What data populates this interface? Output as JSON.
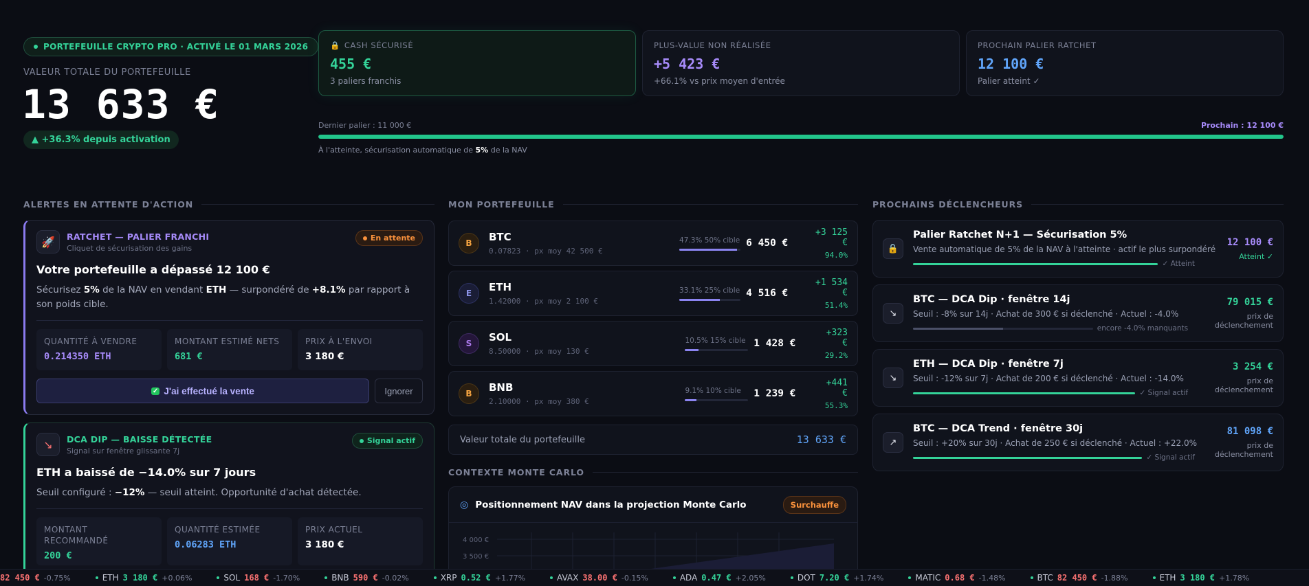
{
  "header": {
    "activation_badge": "PORTEFEUILLE CRYPTO PRO · ACTIVÉ LE 01 MARS 2026",
    "total_label": "VALEUR TOTALE DU PORTEFEUILLE",
    "total_value": "13 633  €",
    "change": "▲ +36.3% depuis activation"
  },
  "kpis": [
    {
      "label": "CASH SÉCURISÉ",
      "value": "455  €",
      "sub": "3 paliers franchis",
      "icon": "lock-icon"
    },
    {
      "label": "PLUS-VALUE NON RÉALISÉE",
      "value": "+5 423  €",
      "sub": "+66.1% vs prix moyen d'entrée"
    },
    {
      "label": "PROCHAIN PALIER RATCHET",
      "value": "12 100  €",
      "sub": "Palier atteint ✓"
    }
  ],
  "progress": {
    "left_label": "Dernier palier : 11 000 €",
    "right_label": "Prochain : 12 100 €",
    "fill": 1.0,
    "note_pre": "À l'atteinte, sécurisation automatique de ",
    "note_bold": "5%",
    "note_post": " de la NAV"
  },
  "columns": {
    "alerts": "ALERTES EN ATTENTE D'ACTION",
    "portfolio": "MON PORTEFEUILLE",
    "triggers": "PROCHAINS DÉCLENCHEURS",
    "monte_carlo": "CONTEXTE MONTE CARLO"
  },
  "alerts": {
    "ratchet": {
      "kind": "RATCHET — PALIER FRANCHI",
      "sub": "Cliquet de sécurisation des gains",
      "status": "En attente",
      "title": "Votre portefeuille a dépassé 12 100 €",
      "desc_1": "Sécurisez ",
      "desc_b1": "5%",
      "desc_2": " de la NAV en vendant ",
      "desc_b2": "ETH",
      "desc_3": " — surpondéré de ",
      "desc_b3": "+8.1%",
      "desc_4": " par rapport à son poids cible.",
      "stats": [
        {
          "label": "QUANTITÉ À VENDRE",
          "value": "0.214350 ETH"
        },
        {
          "label": "MONTANT ESTIMÉ NETS",
          "value": "681  €"
        },
        {
          "label": "PRIX À L'ENVOI",
          "value": "3 180 €"
        }
      ],
      "confirm": "J'ai effectué la vente",
      "ignore": "Ignorer"
    },
    "dca": {
      "kind": "DCA DIP — BAISSE DÉTECTÉE",
      "sub": "Signal sur fenêtre glissante 7j",
      "status": "Signal actif",
      "title": "ETH a baissé de −14.0% sur 7 jours",
      "desc_1": "Seuil configuré : ",
      "desc_b1": "−12%",
      "desc_2": " — seuil atteint. Opportunité d'achat détectée.",
      "stats": [
        {
          "label": "MONTANT RECOMMANDÉ",
          "value": "200  €"
        },
        {
          "label": "QUANTITÉ ESTIMÉE",
          "value": "0.06283 ETH"
        },
        {
          "label": "PRIX ACTUEL",
          "value": "3 180 €"
        }
      ]
    }
  },
  "assets": [
    {
      "coin": "B",
      "sym": "BTC",
      "qty": "0.07823 · px moy 42 500 €",
      "alloc": "47.3%  50% cible",
      "alloc_fill": 0.473,
      "value": "6 450  €",
      "pnl": "+3 125  €",
      "pct": "94.0%",
      "style": "coin-btc"
    },
    {
      "coin": "E",
      "sym": "ETH",
      "qty": "1.42000 · px moy 2 100 €",
      "alloc": "33.1%  25% cible",
      "alloc_fill": 0.331,
      "value": "4 516  €",
      "pnl": "+1 534  €",
      "pct": "51.4%",
      "style": "coin-eth"
    },
    {
      "coin": "S",
      "sym": "SOL",
      "qty": "8.50000 · px moy 130 €",
      "alloc": "10.5%  15% cible",
      "alloc_fill": 0.105,
      "value": "1 428  €",
      "pnl": "+323  €",
      "pct": "29.2%",
      "style": "coin-sol"
    },
    {
      "coin": "B",
      "sym": "BNB",
      "qty": "2.10000 · px moy 380 €",
      "alloc": "9.1%  10% cible",
      "alloc_fill": 0.091,
      "value": "1 239  €",
      "pnl": "+441  €",
      "pct": "55.3%",
      "style": "coin-btc"
    }
  ],
  "portfolio_total": {
    "label": "Valeur totale du portefeuille",
    "value": "13 633  €"
  },
  "monte_carlo": {
    "title": "Positionnement NAV dans la projection Monte Carlo",
    "status": "Surchauffe",
    "y_ticks": [
      "4 000 €",
      "3 500 €"
    ]
  },
  "triggers": [
    {
      "title": "Palier Ratchet N+1 — Sécurisation 5%",
      "desc": "Vente automatique de 5% de la NAV à l'atteinte · actif le plus surpondéré",
      "state": "✓ Atteint",
      "fill": 1.0,
      "price": "12 100  €",
      "note": "Atteint ✓",
      "icon": "lock-icon",
      "color": "#a78bfa"
    },
    {
      "title": "BTC — DCA Dip · fenêtre 14j",
      "desc": "Seuil : -8% sur 14j · Achat de 300 € si déclenché · Actuel : -4.0%",
      "state": "encore -4.0% manquants",
      "fill": 0.5,
      "price": "79 015  €",
      "note": "prix de déclenchement",
      "icon": "chart-down-icon",
      "color": "#34d399"
    },
    {
      "title": "ETH — DCA Dip · fenêtre 7j",
      "desc": "Seuil : -12% sur 7j · Achat de 200 € si déclenché · Actuel : -14.0%",
      "state": "✓ Signal actif",
      "fill": 1.0,
      "price": "3 254  €",
      "note": "prix de déclenchement",
      "icon": "chart-down-icon",
      "color": "#34d399"
    },
    {
      "title": "BTC — DCA Trend · fenêtre 30j",
      "desc": "Seuil : +20% sur 30j · Achat de 250 € si déclenché · Actuel : +22.0%",
      "state": "✓ Signal actif",
      "fill": 1.0,
      "price": "81 098  €",
      "note": "prix de déclenchement",
      "icon": "chart-up-icon",
      "color": "#60a5fa"
    }
  ],
  "ticker": [
    {
      "sym": "",
      "price": "82 450  €",
      "chg": "-0.75%",
      "color": "#f87171"
    },
    {
      "sym": "ETH",
      "price": "3 180  €",
      "chg": "+0.06%",
      "color": "#34d399"
    },
    {
      "sym": "SOL",
      "price": "168  €",
      "chg": "-1.70%",
      "color": "#f87171"
    },
    {
      "sym": "BNB",
      "price": "590  €",
      "chg": "-0.02%",
      "color": "#f87171"
    },
    {
      "sym": "XRP",
      "price": "0.52  €",
      "chg": "+1.77%",
      "color": "#34d399"
    },
    {
      "sym": "AVAX",
      "price": "38.00  €",
      "chg": "-0.15%",
      "color": "#f87171"
    },
    {
      "sym": "ADA",
      "price": "0.47  €",
      "chg": "+2.05%",
      "color": "#34d399"
    },
    {
      "sym": "DOT",
      "price": "7.20  €",
      "chg": "+1.74%",
      "color": "#34d399"
    },
    {
      "sym": "MATIC",
      "price": "0.68  €",
      "chg": "-1.48%",
      "color": "#f87171"
    },
    {
      "sym": "BTC",
      "price": "82 450  €",
      "chg": "-1.88%",
      "color": "#f87171"
    },
    {
      "sym": "ETH",
      "price": "3 180  €",
      "chg": "+1.78%",
      "color": "#34d399"
    }
  ]
}
